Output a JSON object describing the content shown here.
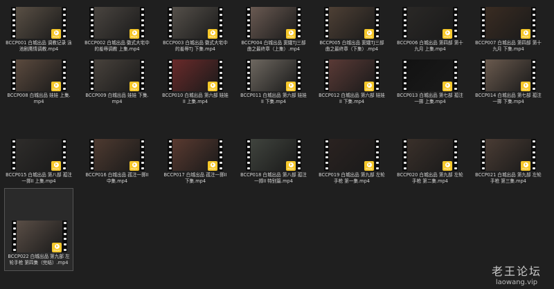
{
  "files": [
    {
      "label": "BCCP001 白城出品 调教记录 泳池剧鹰情调教.mp4",
      "color": "#5a5045"
    },
    {
      "label": "BCCP002 白城出品 徽式大宅中的羞辱调教 上集.mp4",
      "color": "#4a4540"
    },
    {
      "label": "BCCP003 白城出品 徽式大宅中的羞辱TJ 下集.mp4",
      "color": "#55504a"
    },
    {
      "label": "BCCP004 白城出品 窦娥TJ三部曲之最终章（上集）.mp4",
      "color": "#6a5a52"
    },
    {
      "label": "BCCP005 白城出品 窦娥TJ三部曲之最终章（下集）.mp4",
      "color": "#4e4035"
    },
    {
      "label": "BCCP006 白城出品 第四部 第十九月 上集.mp4",
      "color": "#2a2826"
    },
    {
      "label": "BCCP007 白城出品 第四部 第十九月 下集.mp4",
      "color": "#3a2c22"
    },
    {
      "label": "BCCP008 白城出品 娃娃 上集.mp4",
      "color": "#5b4a3e"
    },
    {
      "label": "BCCP009 白城出品 娃娃 下集.mp4",
      "color": "#48423c"
    },
    {
      "label": "BCCP010 白城出品 第六部 娃娃II 上集.mp4",
      "color": "#6a2a2a"
    },
    {
      "label": "BCCP011 白城出品 第六部 娃娃II 下集.mp4",
      "color": "#6e6860"
    },
    {
      "label": "BCCP012 白城出品 第六部 娃娃II 下集.mp4",
      "color": "#5a3a36"
    },
    {
      "label": "BCCP013 白城出品 第七部 孤注一掷 上集.mp4",
      "color": "#121212"
    },
    {
      "label": "BCCP014 白城出品 第七部 孤注一掷 下集.mp4",
      "color": "#6a5a4e"
    },
    {
      "label": "BCCP015 白城出品 第八部 孤注一掷II 上集.mp4",
      "color": "#2e2c2a"
    },
    {
      "label": "BCCP016 白城出品 孤注一掷II 中集.mp4",
      "color": "#4e3a30"
    },
    {
      "label": "BCCP017 白城出品 孤注一掷II 下集.mp4",
      "color": "#5a3a30"
    },
    {
      "label": "BCCP018 白城出品 第八部 孤注一掷II 特别篇.mp4",
      "color": "#40443e"
    },
    {
      "label": "BCCP019 白城出品 第九部 左轮手枪 第一集.mp4",
      "color": "#2a2220"
    },
    {
      "label": "BCCP020 白城出品 第九部 左轮手枪 第二集.mp4",
      "color": "#3a302a"
    },
    {
      "label": "BCCP021 白城出品 第九部 左轮手枪 第三集.mp4",
      "color": "#4a3c34"
    },
    {
      "label": "BCCP022 白城出品 第九部 左轮手枪 第四集（完结）.mp4",
      "color": "#5a4e46"
    }
  ],
  "badge_text": "Player",
  "watermark": {
    "title": "老王论坛",
    "url": "laowang.vip"
  }
}
